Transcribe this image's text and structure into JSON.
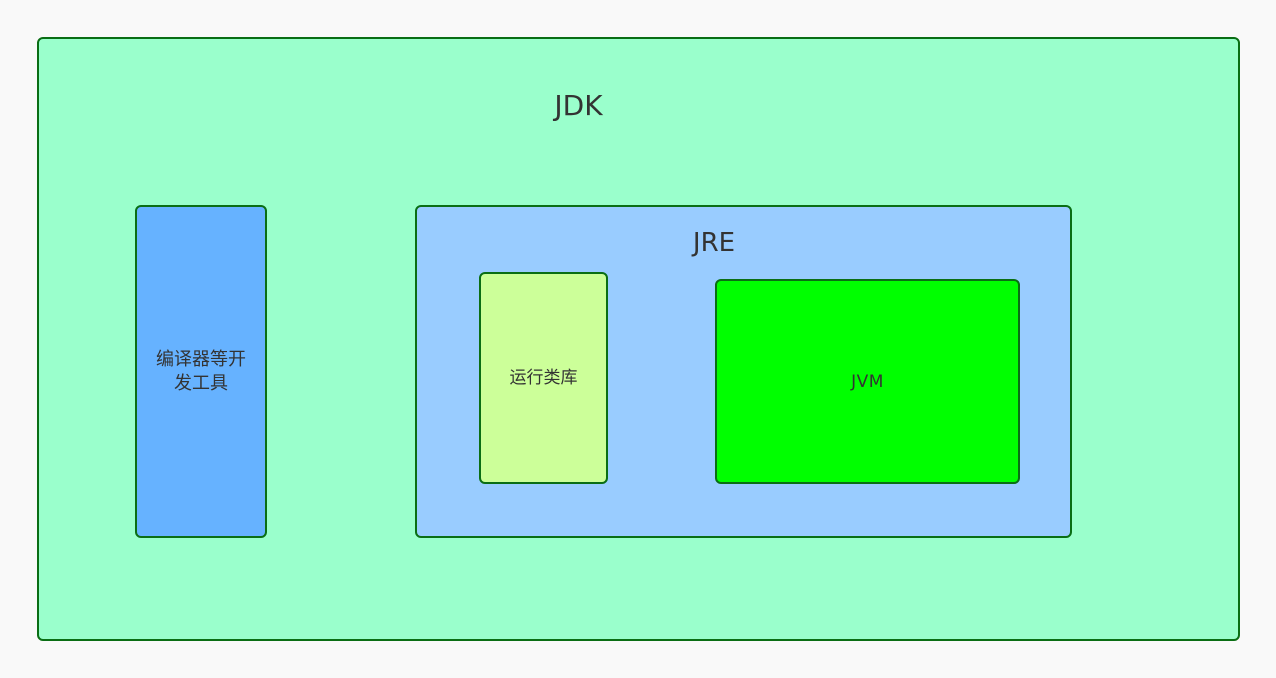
{
  "diagram": {
    "jdk": {
      "label": "JDK"
    },
    "tools": {
      "label": "编译器等开发工具"
    },
    "jre": {
      "label": "JRE"
    },
    "runtime_library": {
      "label": "运行类库"
    },
    "jvm": {
      "label": "JVM"
    }
  },
  "colors": {
    "background": "#f9f9f9",
    "jdk_fill": "#9affcc",
    "tools_fill": "#66b2ff",
    "jre_fill": "#99ccff",
    "runtime_library_fill": "#ccff99",
    "jvm_fill": "#00ff00",
    "border": "#0a6e14",
    "text": "#333333"
  }
}
